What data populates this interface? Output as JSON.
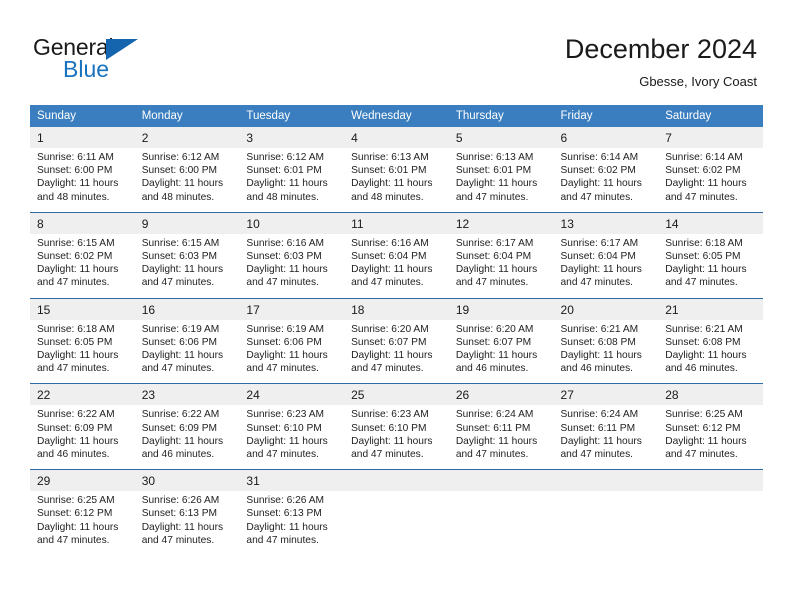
{
  "brand": {
    "name_top": "General",
    "name_bottom": "Blue",
    "triangle_color": "#1565ae",
    "text_color": "#1a1a1a",
    "blue_color": "#1773bf"
  },
  "header": {
    "title": "December 2024",
    "subtitle": "Gbesse, Ivory Coast"
  },
  "theme": {
    "header_bg": "#3a7ebf",
    "daynum_bg": "#efefef",
    "separator": "#2f6aa8",
    "text": "#222222"
  },
  "calendar": {
    "weekdays": [
      "Sunday",
      "Monday",
      "Tuesday",
      "Wednesday",
      "Thursday",
      "Friday",
      "Saturday"
    ],
    "weeks": [
      [
        {
          "day": "1",
          "sunrise": "Sunrise: 6:11 AM",
          "sunset": "Sunset: 6:00 PM",
          "daylight1": "Daylight: 11 hours",
          "daylight2": "and 48 minutes."
        },
        {
          "day": "2",
          "sunrise": "Sunrise: 6:12 AM",
          "sunset": "Sunset: 6:00 PM",
          "daylight1": "Daylight: 11 hours",
          "daylight2": "and 48 minutes."
        },
        {
          "day": "3",
          "sunrise": "Sunrise: 6:12 AM",
          "sunset": "Sunset: 6:01 PM",
          "daylight1": "Daylight: 11 hours",
          "daylight2": "and 48 minutes."
        },
        {
          "day": "4",
          "sunrise": "Sunrise: 6:13 AM",
          "sunset": "Sunset: 6:01 PM",
          "daylight1": "Daylight: 11 hours",
          "daylight2": "and 48 minutes."
        },
        {
          "day": "5",
          "sunrise": "Sunrise: 6:13 AM",
          "sunset": "Sunset: 6:01 PM",
          "daylight1": "Daylight: 11 hours",
          "daylight2": "and 47 minutes."
        },
        {
          "day": "6",
          "sunrise": "Sunrise: 6:14 AM",
          "sunset": "Sunset: 6:02 PM",
          "daylight1": "Daylight: 11 hours",
          "daylight2": "and 47 minutes."
        },
        {
          "day": "7",
          "sunrise": "Sunrise: 6:14 AM",
          "sunset": "Sunset: 6:02 PM",
          "daylight1": "Daylight: 11 hours",
          "daylight2": "and 47 minutes."
        }
      ],
      [
        {
          "day": "8",
          "sunrise": "Sunrise: 6:15 AM",
          "sunset": "Sunset: 6:02 PM",
          "daylight1": "Daylight: 11 hours",
          "daylight2": "and 47 minutes."
        },
        {
          "day": "9",
          "sunrise": "Sunrise: 6:15 AM",
          "sunset": "Sunset: 6:03 PM",
          "daylight1": "Daylight: 11 hours",
          "daylight2": "and 47 minutes."
        },
        {
          "day": "10",
          "sunrise": "Sunrise: 6:16 AM",
          "sunset": "Sunset: 6:03 PM",
          "daylight1": "Daylight: 11 hours",
          "daylight2": "and 47 minutes."
        },
        {
          "day": "11",
          "sunrise": "Sunrise: 6:16 AM",
          "sunset": "Sunset: 6:04 PM",
          "daylight1": "Daylight: 11 hours",
          "daylight2": "and 47 minutes."
        },
        {
          "day": "12",
          "sunrise": "Sunrise: 6:17 AM",
          "sunset": "Sunset: 6:04 PM",
          "daylight1": "Daylight: 11 hours",
          "daylight2": "and 47 minutes."
        },
        {
          "day": "13",
          "sunrise": "Sunrise: 6:17 AM",
          "sunset": "Sunset: 6:04 PM",
          "daylight1": "Daylight: 11 hours",
          "daylight2": "and 47 minutes."
        },
        {
          "day": "14",
          "sunrise": "Sunrise: 6:18 AM",
          "sunset": "Sunset: 6:05 PM",
          "daylight1": "Daylight: 11 hours",
          "daylight2": "and 47 minutes."
        }
      ],
      [
        {
          "day": "15",
          "sunrise": "Sunrise: 6:18 AM",
          "sunset": "Sunset: 6:05 PM",
          "daylight1": "Daylight: 11 hours",
          "daylight2": "and 47 minutes."
        },
        {
          "day": "16",
          "sunrise": "Sunrise: 6:19 AM",
          "sunset": "Sunset: 6:06 PM",
          "daylight1": "Daylight: 11 hours",
          "daylight2": "and 47 minutes."
        },
        {
          "day": "17",
          "sunrise": "Sunrise: 6:19 AM",
          "sunset": "Sunset: 6:06 PM",
          "daylight1": "Daylight: 11 hours",
          "daylight2": "and 47 minutes."
        },
        {
          "day": "18",
          "sunrise": "Sunrise: 6:20 AM",
          "sunset": "Sunset: 6:07 PM",
          "daylight1": "Daylight: 11 hours",
          "daylight2": "and 47 minutes."
        },
        {
          "day": "19",
          "sunrise": "Sunrise: 6:20 AM",
          "sunset": "Sunset: 6:07 PM",
          "daylight1": "Daylight: 11 hours",
          "daylight2": "and 46 minutes."
        },
        {
          "day": "20",
          "sunrise": "Sunrise: 6:21 AM",
          "sunset": "Sunset: 6:08 PM",
          "daylight1": "Daylight: 11 hours",
          "daylight2": "and 46 minutes."
        },
        {
          "day": "21",
          "sunrise": "Sunrise: 6:21 AM",
          "sunset": "Sunset: 6:08 PM",
          "daylight1": "Daylight: 11 hours",
          "daylight2": "and 46 minutes."
        }
      ],
      [
        {
          "day": "22",
          "sunrise": "Sunrise: 6:22 AM",
          "sunset": "Sunset: 6:09 PM",
          "daylight1": "Daylight: 11 hours",
          "daylight2": "and 46 minutes."
        },
        {
          "day": "23",
          "sunrise": "Sunrise: 6:22 AM",
          "sunset": "Sunset: 6:09 PM",
          "daylight1": "Daylight: 11 hours",
          "daylight2": "and 46 minutes."
        },
        {
          "day": "24",
          "sunrise": "Sunrise: 6:23 AM",
          "sunset": "Sunset: 6:10 PM",
          "daylight1": "Daylight: 11 hours",
          "daylight2": "and 47 minutes."
        },
        {
          "day": "25",
          "sunrise": "Sunrise: 6:23 AM",
          "sunset": "Sunset: 6:10 PM",
          "daylight1": "Daylight: 11 hours",
          "daylight2": "and 47 minutes."
        },
        {
          "day": "26",
          "sunrise": "Sunrise: 6:24 AM",
          "sunset": "Sunset: 6:11 PM",
          "daylight1": "Daylight: 11 hours",
          "daylight2": "and 47 minutes."
        },
        {
          "day": "27",
          "sunrise": "Sunrise: 6:24 AM",
          "sunset": "Sunset: 6:11 PM",
          "daylight1": "Daylight: 11 hours",
          "daylight2": "and 47 minutes."
        },
        {
          "day": "28",
          "sunrise": "Sunrise: 6:25 AM",
          "sunset": "Sunset: 6:12 PM",
          "daylight1": "Daylight: 11 hours",
          "daylight2": "and 47 minutes."
        }
      ],
      [
        {
          "day": "29",
          "sunrise": "Sunrise: 6:25 AM",
          "sunset": "Sunset: 6:12 PM",
          "daylight1": "Daylight: 11 hours",
          "daylight2": "and 47 minutes."
        },
        {
          "day": "30",
          "sunrise": "Sunrise: 6:26 AM",
          "sunset": "Sunset: 6:13 PM",
          "daylight1": "Daylight: 11 hours",
          "daylight2": "and 47 minutes."
        },
        {
          "day": "31",
          "sunrise": "Sunrise: 6:26 AM",
          "sunset": "Sunset: 6:13 PM",
          "daylight1": "Daylight: 11 hours",
          "daylight2": "and 47 minutes."
        },
        {
          "day": "",
          "sunrise": "",
          "sunset": "",
          "daylight1": "",
          "daylight2": ""
        },
        {
          "day": "",
          "sunrise": "",
          "sunset": "",
          "daylight1": "",
          "daylight2": ""
        },
        {
          "day": "",
          "sunrise": "",
          "sunset": "",
          "daylight1": "",
          "daylight2": ""
        },
        {
          "day": "",
          "sunrise": "",
          "sunset": "",
          "daylight1": "",
          "daylight2": ""
        }
      ]
    ]
  }
}
